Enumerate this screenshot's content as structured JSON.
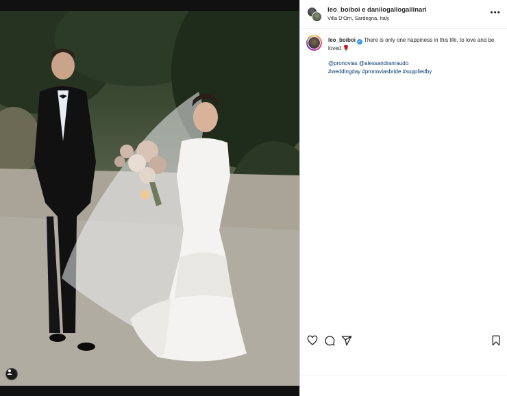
{
  "post": {
    "header": {
      "users": "leo_boiboi e danilogallogallinari",
      "location": "Villa D'Orri, Sardegna, Italy",
      "more_label": "•••"
    },
    "caption": {
      "username": "leo_boiboi",
      "verified": true,
      "text": "There is only one happiness in this life, to love and be loved",
      "emoji": "🌹",
      "mentions": "@pronovias @alessandranraudo",
      "hashtags": "#weddingday #pronoviasbride #suppliedby"
    },
    "actions": {
      "like_icon": "heart-icon",
      "comment_icon": "comment-icon",
      "share_icon": "paper-plane-icon",
      "save_icon": "bookmark-icon"
    },
    "photo": {
      "tag_icon": "person-tag-icon"
    }
  },
  "colors": {
    "link": "#00376b",
    "verified": "#3897f0",
    "text": "#262626",
    "border": "#dbdbdb"
  }
}
